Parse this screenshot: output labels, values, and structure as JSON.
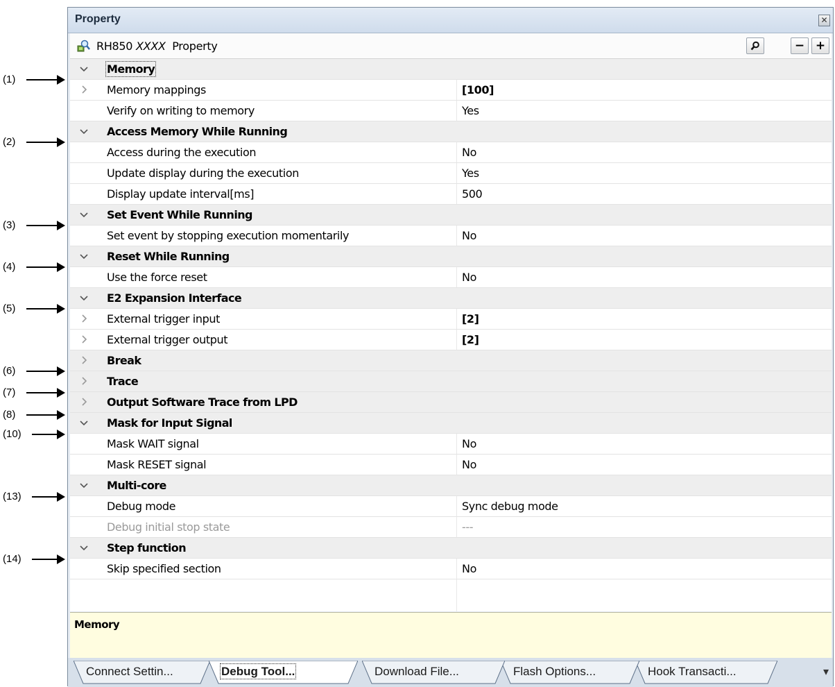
{
  "callouts": [
    "(1)",
    "(2)",
    "(3)",
    "(4)",
    "(5)",
    "(6)",
    "(7)",
    "(8)",
    "(10)",
    "(13)",
    "(14)"
  ],
  "window": {
    "title": "Property"
  },
  "toolbar": {
    "title_prefix": "RH850",
    "title_device": "XXXX",
    "title_suffix": "Property",
    "minus_label": "−",
    "plus_label": "+",
    "search_icon": "magnifier-icon"
  },
  "rows": [
    {
      "type": "category",
      "expanded": true,
      "name": "Memory"
    },
    {
      "type": "property",
      "expandable": true,
      "name": "Memory mappings",
      "value": "[100]",
      "bold": true
    },
    {
      "type": "property",
      "name": "Verify on writing to memory",
      "value": "Yes"
    },
    {
      "type": "category",
      "expanded": true,
      "name": "Access Memory While Running"
    },
    {
      "type": "property",
      "name": "Access during the execution",
      "value": "No"
    },
    {
      "type": "property",
      "name": "Update display during the execution",
      "value": "Yes"
    },
    {
      "type": "property",
      "name": "Display update interval[ms]",
      "value": "500"
    },
    {
      "type": "category",
      "expanded": true,
      "name": "Set Event While Running"
    },
    {
      "type": "property",
      "name": "Set event by stopping execution momentarily",
      "value": "No"
    },
    {
      "type": "category",
      "expanded": true,
      "name": "Reset While Running"
    },
    {
      "type": "property",
      "name": "Use the force reset",
      "value": "No"
    },
    {
      "type": "category",
      "expanded": true,
      "name": "E2 Expansion Interface"
    },
    {
      "type": "property",
      "expandable": true,
      "name": "External trigger input",
      "value": "[2]",
      "bold": true
    },
    {
      "type": "property",
      "expandable": true,
      "name": "External trigger output",
      "value": "[2]",
      "bold": true
    },
    {
      "type": "category",
      "expanded": false,
      "name": "Break"
    },
    {
      "type": "category",
      "expanded": false,
      "name": "Trace"
    },
    {
      "type": "category",
      "expanded": false,
      "name": "Output Software Trace from LPD"
    },
    {
      "type": "category",
      "expanded": true,
      "name": "Mask for Input Signal"
    },
    {
      "type": "property",
      "name": "Mask WAIT signal",
      "value": "No"
    },
    {
      "type": "property",
      "name": "Mask RESET signal",
      "value": "No"
    },
    {
      "type": "category",
      "expanded": true,
      "name": "Multi-core"
    },
    {
      "type": "property",
      "name": "Debug mode",
      "value": "Sync debug mode"
    },
    {
      "type": "property",
      "name": "Debug initial stop state",
      "value": "---",
      "disabled": true
    },
    {
      "type": "category",
      "expanded": true,
      "name": "Step function"
    },
    {
      "type": "property",
      "name": "Skip specified section",
      "value": "No"
    }
  ],
  "description": {
    "title": "Memory"
  },
  "tabs": [
    {
      "label": "Connect Settin...",
      "active": false
    },
    {
      "label": "Debug Tool...",
      "active": true
    },
    {
      "label": "Download File...",
      "active": false
    },
    {
      "label": "Flash Options...",
      "active": false
    },
    {
      "label": "Hook Transacti...",
      "active": false
    }
  ],
  "tab_overflow_icon": "overflow-menu-icon"
}
